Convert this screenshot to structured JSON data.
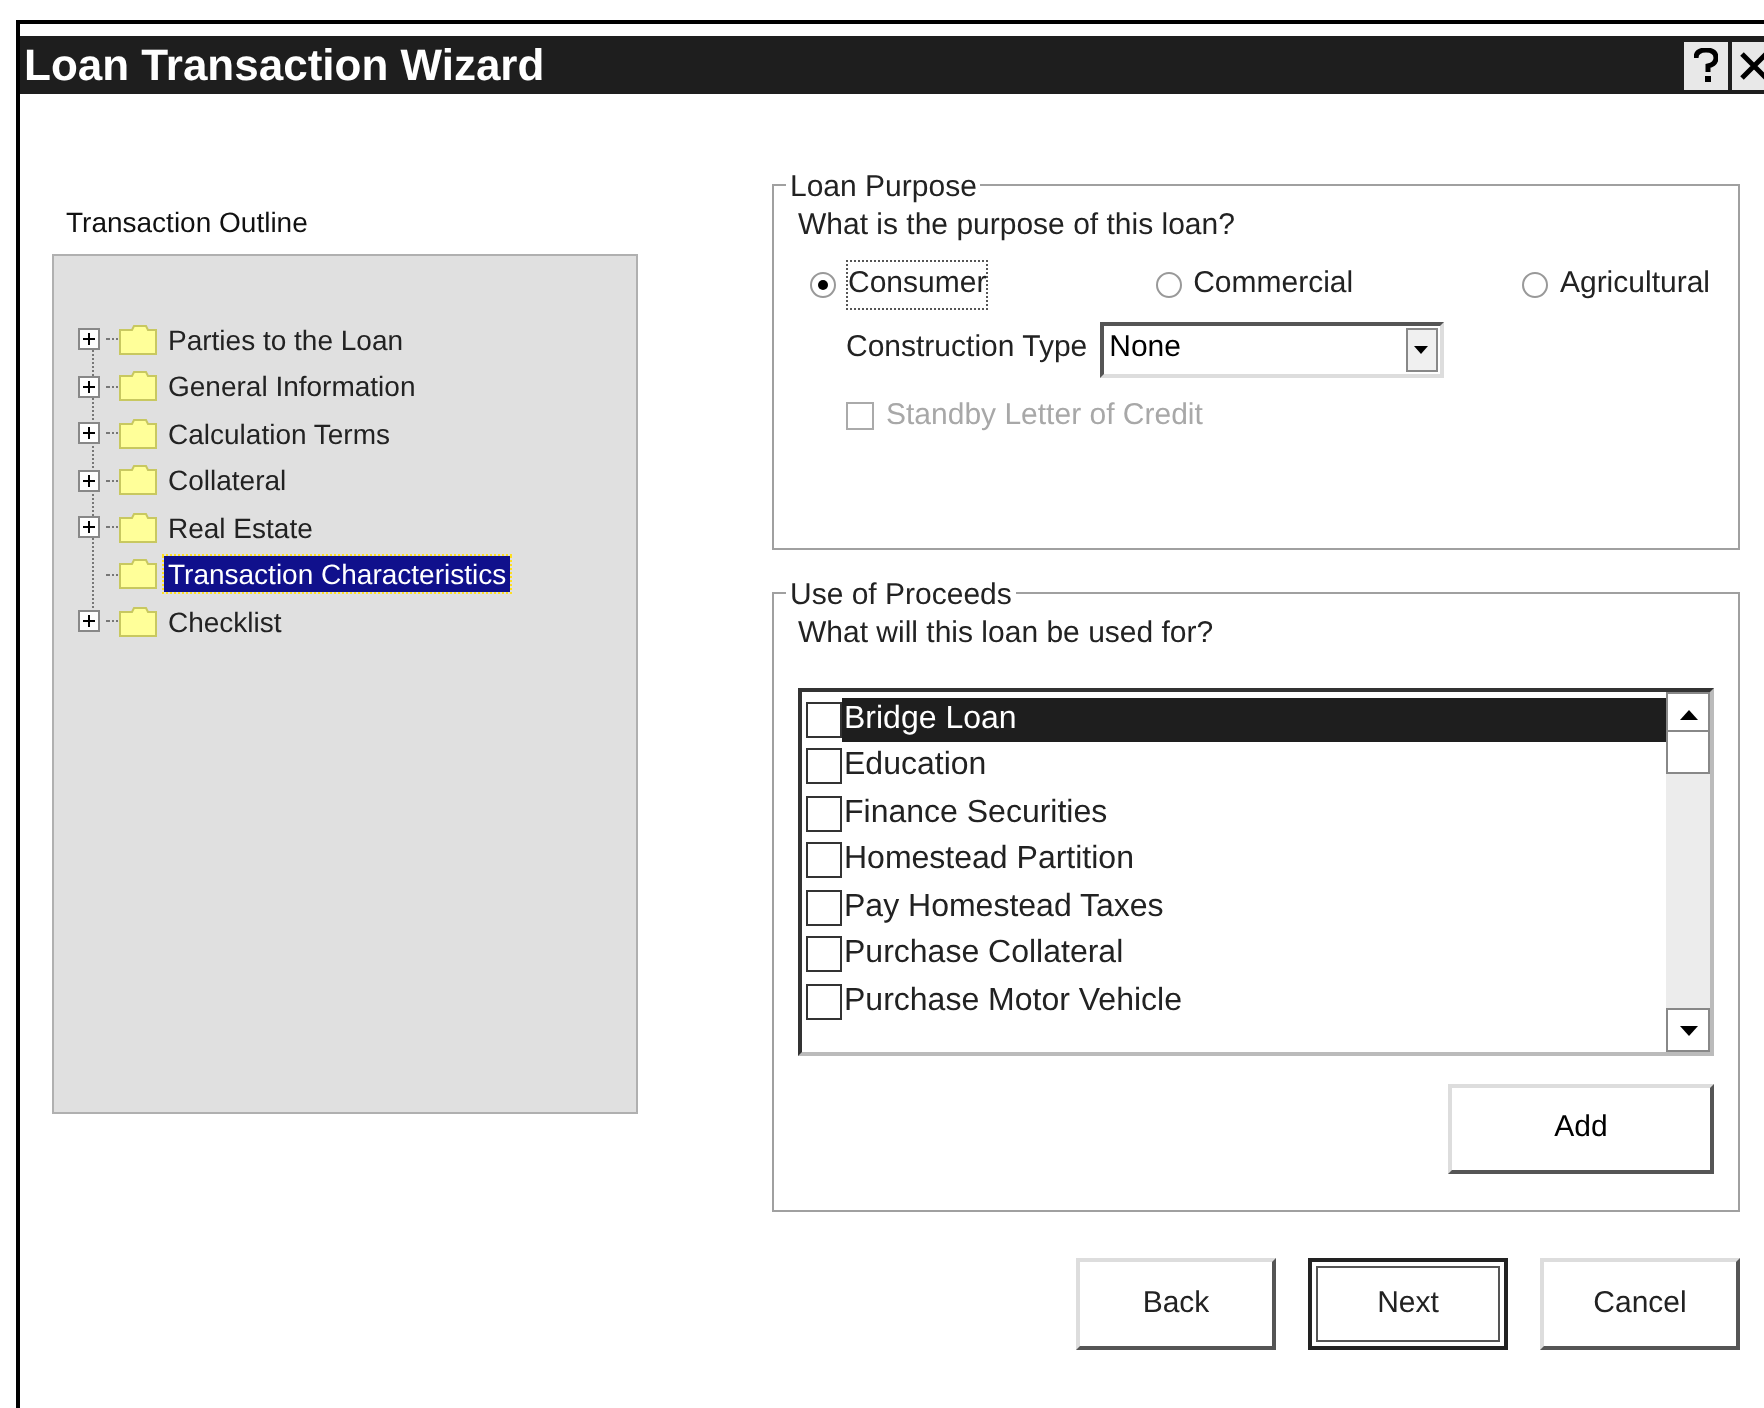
{
  "window": {
    "title": "Loan Transaction Wizard"
  },
  "outline": {
    "title": "Transaction Outline",
    "items": [
      {
        "label": "Parties to the Loan",
        "expandable": true,
        "selected": false
      },
      {
        "label": "General Information",
        "expandable": true,
        "selected": false
      },
      {
        "label": "Calculation Terms",
        "expandable": true,
        "selected": false
      },
      {
        "label": "Collateral",
        "expandable": true,
        "selected": false
      },
      {
        "label": "Real Estate",
        "expandable": true,
        "selected": false
      },
      {
        "label": "Transaction Characteristics",
        "expandable": false,
        "selected": true
      },
      {
        "label": "Checklist",
        "expandable": true,
        "selected": false
      }
    ]
  },
  "loan_purpose": {
    "title": "Loan Purpose",
    "question": "What is the purpose of this loan?",
    "options": [
      {
        "label": "Consumer",
        "selected": true
      },
      {
        "label": "Commercial",
        "selected": false
      },
      {
        "label": "Agricultural",
        "selected": false
      }
    ],
    "construction_type": {
      "label": "Construction Type",
      "value": "None"
    },
    "standby": {
      "label": "Standby Letter of Credit",
      "checked": false,
      "disabled": true
    }
  },
  "use_of_proceeds": {
    "title": "Use of Proceeds",
    "question": "What will this loan be used for?",
    "items": [
      {
        "label": "Bridge Loan",
        "checked": false,
        "selected": true
      },
      {
        "label": "Education",
        "checked": false,
        "selected": false
      },
      {
        "label": "Finance Securities",
        "checked": false,
        "selected": false
      },
      {
        "label": "Homestead Partition",
        "checked": false,
        "selected": false
      },
      {
        "label": "Pay Homestead Taxes",
        "checked": false,
        "selected": false
      },
      {
        "label": "Purchase Collateral",
        "checked": false,
        "selected": false
      },
      {
        "label": "Purchase Motor Vehicle",
        "checked": false,
        "selected": false
      }
    ],
    "add_button": "Add"
  },
  "buttons": [
    {
      "label": "Back",
      "default": false
    },
    {
      "label": "Next",
      "default": true
    },
    {
      "label": "Cancel",
      "default": false
    }
  ]
}
